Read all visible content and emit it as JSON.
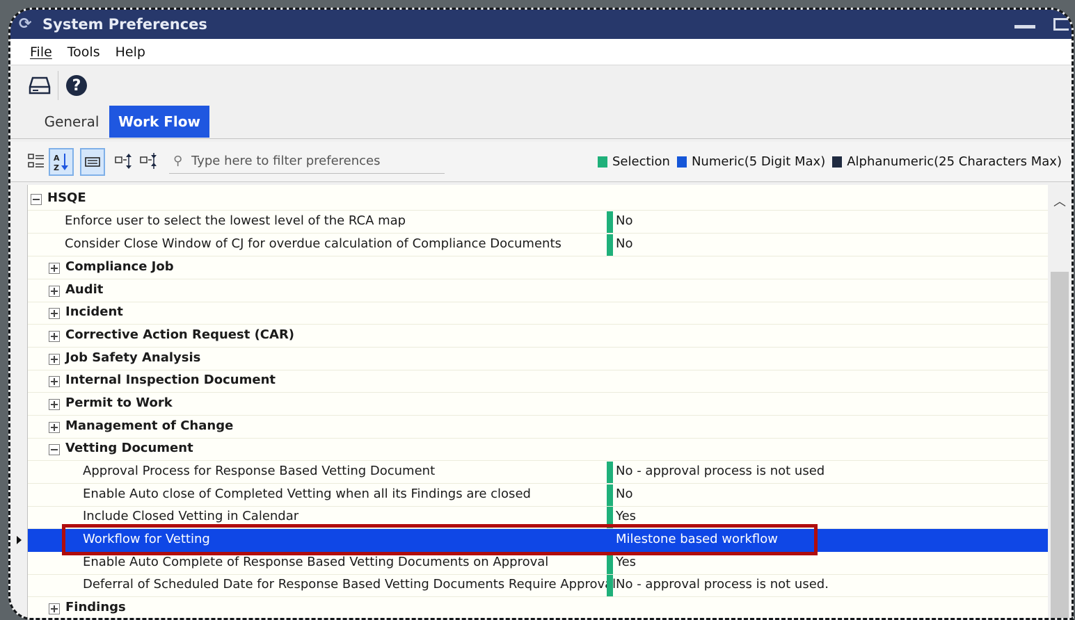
{
  "window": {
    "title": "System Preferences"
  },
  "menu": [
    "File",
    "Tools",
    "Help"
  ],
  "icons": {
    "app": "app-icon",
    "save": "drive-icon",
    "help": "help-circle-icon",
    "categorized": "categorized-view-icon",
    "sort": "sort-az-icon",
    "property_pages": "property-pages-icon",
    "expand_all": "expand-all-icon",
    "collapse_all": "collapse-all-icon",
    "search": "search-icon",
    "scroll_up": "chevron-up-icon",
    "row_pointer": "row-pointer-icon"
  },
  "tabs": [
    {
      "label": "General",
      "active": false
    },
    {
      "label": "Work Flow",
      "active": true
    }
  ],
  "filter": {
    "placeholder": "Type here to filter preferences"
  },
  "legend": [
    {
      "label": "Selection",
      "color": "#1fb07a"
    },
    {
      "label": "Numeric(5 Digit Max)",
      "color": "#1556d8"
    },
    {
      "label": "Alphanumeric(25 Characters Max)",
      "color": "#1f2a40"
    }
  ],
  "tree": [
    {
      "label": "HSQE",
      "level": 0,
      "type": "group",
      "state": "expanded"
    },
    {
      "label": "Enforce user to select the lowest level of the RCA map",
      "level": 1,
      "type": "pref",
      "value": "No"
    },
    {
      "label": "Consider Close Window of CJ for overdue calculation of Compliance Documents",
      "level": 1,
      "type": "pref",
      "value": "No"
    },
    {
      "label": "Compliance Job",
      "level": 1,
      "type": "group",
      "state": "collapsed"
    },
    {
      "label": "Audit",
      "level": 1,
      "type": "group",
      "state": "collapsed"
    },
    {
      "label": "Incident",
      "level": 1,
      "type": "group",
      "state": "collapsed"
    },
    {
      "label": "Corrective Action Request (CAR)",
      "level": 1,
      "type": "group",
      "state": "collapsed"
    },
    {
      "label": "Job Safety Analysis",
      "level": 1,
      "type": "group",
      "state": "collapsed"
    },
    {
      "label": "Internal Inspection Document",
      "level": 1,
      "type": "group",
      "state": "collapsed"
    },
    {
      "label": "Permit to Work",
      "level": 1,
      "type": "group",
      "state": "collapsed"
    },
    {
      "label": "Management of Change",
      "level": 1,
      "type": "group",
      "state": "collapsed"
    },
    {
      "label": "Vetting Document",
      "level": 1,
      "type": "group",
      "state": "expanded"
    },
    {
      "label": "Approval Process for Response Based Vetting Document",
      "level": 2,
      "type": "pref",
      "value": "No - approval process is not used"
    },
    {
      "label": "Enable Auto close of Completed Vetting when all its Findings are closed",
      "level": 2,
      "type": "pref",
      "value": "No"
    },
    {
      "label": "Include Closed Vetting in Calendar",
      "level": 2,
      "type": "pref",
      "value": "Yes"
    },
    {
      "label": "Workflow for Vetting",
      "level": 2,
      "type": "pref",
      "value": "Milestone based workflow",
      "selected": true
    },
    {
      "label": "Enable Auto Complete of Response Based Vetting Documents on Approval",
      "level": 2,
      "type": "pref",
      "value": "Yes"
    },
    {
      "label": "Deferral of Scheduled Date for Response Based Vetting Documents Require Approval",
      "level": 2,
      "type": "pref",
      "value": "No - approval process is not used."
    },
    {
      "label": "Findings",
      "level": 1,
      "type": "group",
      "state": "collapsed"
    }
  ],
  "colors": {
    "titlebar": "#27386b",
    "accent": "#1f57e0",
    "selection": "#0f47e6",
    "highlight": "#b00d0d"
  }
}
